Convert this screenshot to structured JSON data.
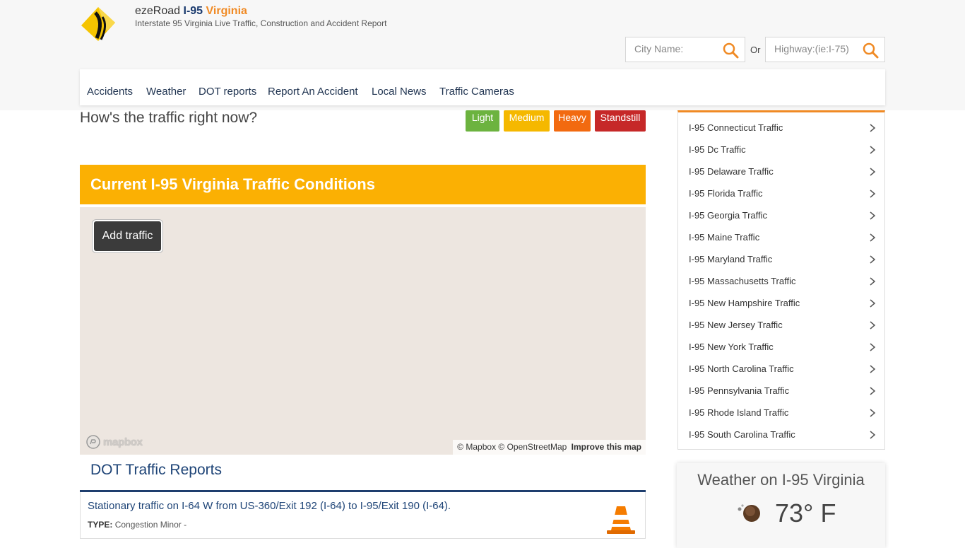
{
  "brand": {
    "name": "ezeRoad",
    "highway": "I-95",
    "state": "Virginia",
    "tagline": "Interstate 95 Virginia Live Traffic, Construction and Accident Report"
  },
  "search": {
    "city_placeholder": "City Name:",
    "or_label": "Or",
    "highway_placeholder": "Highway:(ie:I-75)"
  },
  "nav": {
    "items": [
      "Accidents",
      "Weather",
      "DOT reports",
      "Report An Accident",
      "Local News",
      "Traffic Cameras"
    ]
  },
  "traffic_question": {
    "text": "How's the traffic right now?",
    "buttons": [
      {
        "label": "Light",
        "color": "#6cb33f"
      },
      {
        "label": "Medium",
        "color": "#f5b800"
      },
      {
        "label": "Heavy",
        "color": "#f26a10"
      },
      {
        "label": "Standstill",
        "color": "#c62828"
      }
    ]
  },
  "conditions": {
    "title": "Current I-95 Virginia Traffic Conditions",
    "banner_color": "#fbb003"
  },
  "map": {
    "add_traffic_label": "Add traffic",
    "logo_text": "mapbox",
    "attribution": "© Mapbox © OpenStreetMap",
    "improve_label": "Improve this map"
  },
  "dot_reports": {
    "title": "DOT Traffic Reports",
    "items": [
      {
        "text": "Stationary traffic on I-64 W from US-360/Exit 192 (I-64) to I-95/Exit 190 (I-64).",
        "type_label": "TYPE:",
        "type_value": "Congestion Minor -",
        "icon": "traffic-cone-icon"
      }
    ]
  },
  "sidebar": {
    "accent_color": "#f08a24",
    "items": [
      "I-95 Connecticut Traffic",
      "I-95 Dc Traffic",
      "I-95 Delaware Traffic",
      "I-95 Florida Traffic",
      "I-95 Georgia Traffic",
      "I-95 Maine Traffic",
      "I-95 Maryland Traffic",
      "I-95 Massachusetts Traffic",
      "I-95 New Hampshire Traffic",
      "I-95 New Jersey Traffic",
      "I-95 New York Traffic",
      "I-95 North Carolina Traffic",
      "I-95 Pennsylvania Traffic",
      "I-95 Rhode Island Traffic",
      "I-95 South Carolina Traffic"
    ]
  },
  "weather": {
    "title": "Weather on I-95 Virginia",
    "temperature": "73° F",
    "icon": "weather-icon"
  }
}
